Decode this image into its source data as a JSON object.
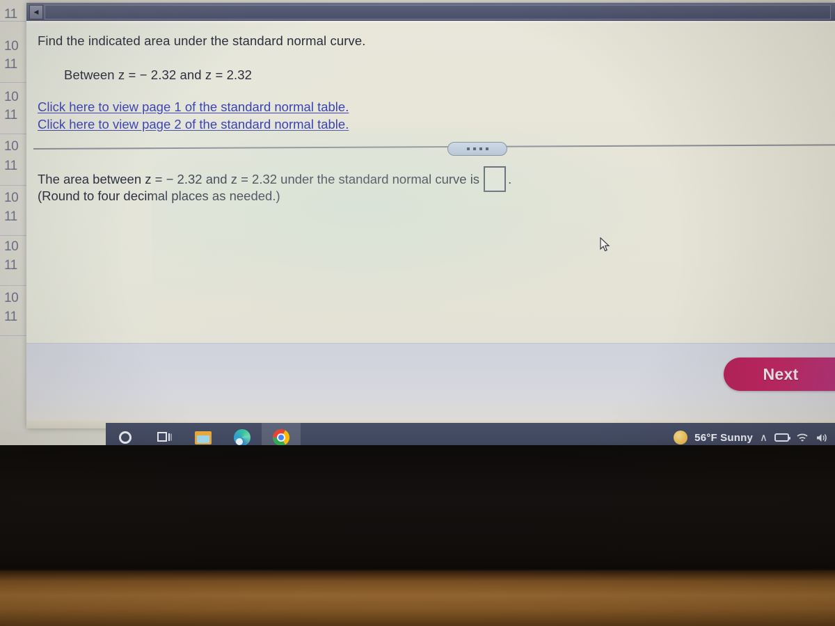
{
  "window": {
    "back_button_icon": "left-arrow-icon"
  },
  "question": {
    "prompt": "Find the indicated area under the standard normal curve.",
    "condition": "Between z = − 2.32 and z = 2.32",
    "links": [
      "Click here to view page 1 of the standard normal table.",
      "Click here to view page 2 of the standard normal table."
    ],
    "answer_prefix": "The area between z = − 2.32 and z = 2.32 under the standard normal curve is",
    "answer_suffix": ".",
    "answer_value": "",
    "answer_placeholder": "",
    "rounding_note": "(Round to four decimal places as needed.)"
  },
  "toolbar": {
    "next_label": "Next",
    "next_color": "#b52359"
  },
  "background_numbers": [
    "11",
    "10",
    "11",
    "10",
    "11",
    "10",
    "11",
    "10",
    "11",
    "10",
    "11",
    "10",
    "11"
  ],
  "taskbar": {
    "items": [
      {
        "name": "cortana",
        "icon": "cortana-circle-icon",
        "active": false
      },
      {
        "name": "task-view",
        "icon": "task-view-icon",
        "active": false
      },
      {
        "name": "file-explorer",
        "icon": "folder-icon",
        "active": false
      },
      {
        "name": "microsoft-edge",
        "icon": "edge-icon",
        "active": false
      },
      {
        "name": "google-chrome",
        "icon": "chrome-icon",
        "active": true
      }
    ],
    "weather": "56°F  Sunny",
    "weather_icon": "sun-icon",
    "tray": [
      {
        "name": "show-hidden-icons",
        "glyph": "∧"
      },
      {
        "name": "battery-icon",
        "glyph": ""
      },
      {
        "name": "wifi-icon",
        "glyph": "◠"
      },
      {
        "name": "volume-icon",
        "glyph": "⧖"
      }
    ]
  },
  "colors": {
    "paper": "#e7e5d9",
    "link": "#3c42b4",
    "text": "#2a2d3d",
    "titlebar": "#545a72",
    "taskbar": "#414960"
  }
}
